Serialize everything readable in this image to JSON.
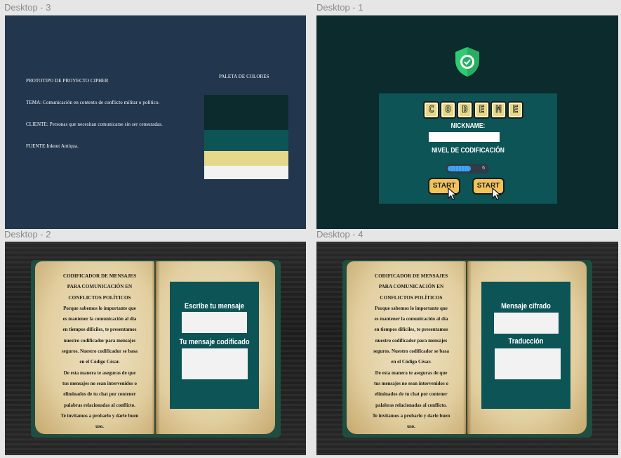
{
  "frames": {
    "desktop3": {
      "label": "Desktop - 3"
    },
    "desktop1": {
      "label": "Desktop - 1"
    },
    "desktop2": {
      "label": "Desktop - 2"
    },
    "desktop4": {
      "label": "Desktop - 4"
    }
  },
  "desktop3": {
    "heading": "PROTOTIPO DE PROYECTO CIPHER",
    "tema": "TEMA: Comunicación en contexto de conflicto militar o político.",
    "cliente": "CLIENTE: Personas que necesitan comunicarse sin ser censuradas.",
    "fuente": "FUENTE:Inknut Antiqua.",
    "palette_title": "PALETA DE COLORES",
    "palette": [
      "#0b2b2d",
      "#0d5456",
      "#e5d88a",
      "#f2f2f2"
    ]
  },
  "desktop1": {
    "logo_letters": [
      "C",
      "O",
      "D",
      "E",
      "M",
      "E"
    ],
    "nickname_label": "NICKNAME:",
    "level_label": "NIVEL DE CODIFICACIÓN",
    "level_value": "6",
    "level_fraction": 0.65,
    "start_labels": [
      "START",
      "START"
    ],
    "icon": "shield-check-icon"
  },
  "book": {
    "lines": [
      "CODIFICADOR DE MENSAJES",
      "PARA COMUNICACIÓN EN",
      "CONFLICTOS POLÍTICOS",
      "Porque sabemos lo importante que",
      "es mantener la comunicación al día",
      "en tiempos difíciles, te presentamos",
      "nuestro codificador para mensajes",
      "seguros. Nuestro codificador se basa",
      "en el Código César.",
      "De esta manera te aseguras de que",
      "tus mensajes no sean intervenidos o",
      "eliminados de tu chat por contener",
      "palabras relacionadas al conflicto.",
      "Te invitamos a probarlo y darle buen",
      "uso."
    ]
  },
  "desktop2": {
    "input_title": "Escribe tu mensaje",
    "output_title": "Tu mensaje codificado"
  },
  "desktop4": {
    "input_title": "Mensaje cifrado",
    "output_title": "Traducción"
  }
}
